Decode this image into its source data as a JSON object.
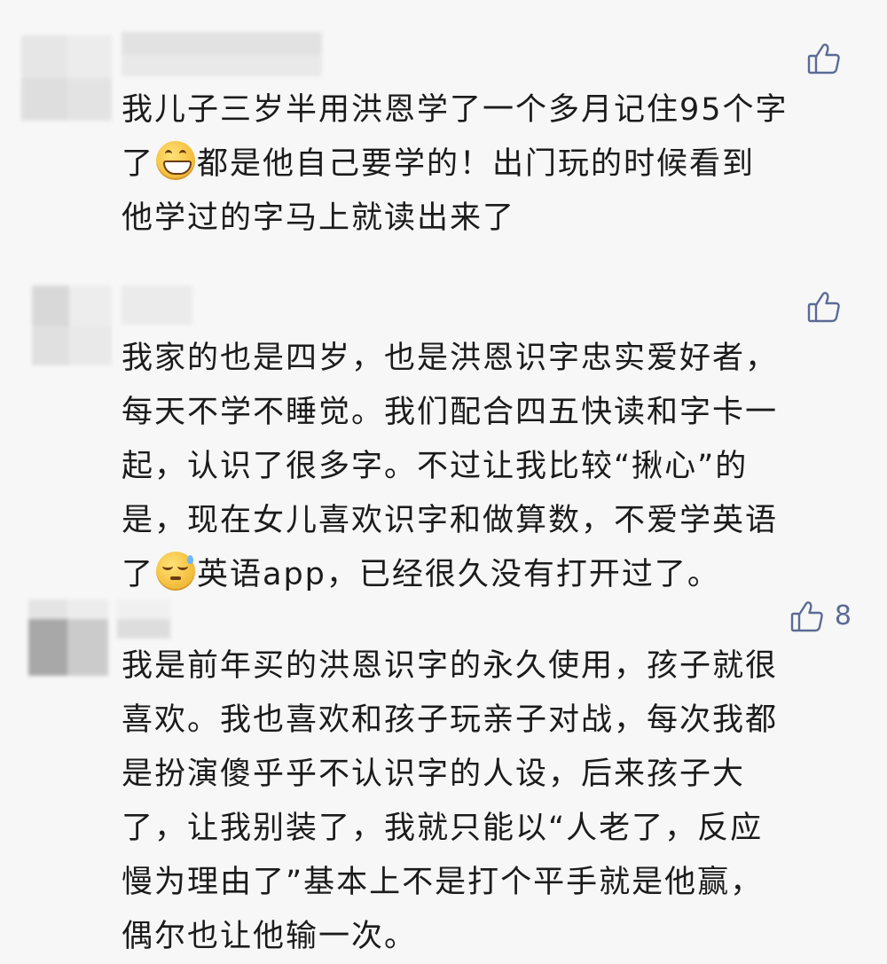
{
  "comments": [
    {
      "likes": "",
      "lines": [
        {
          "pre": "我儿子三岁半用洪恩学了一个多月记住95个字",
          "emoji": "",
          "post": ""
        },
        {
          "pre": "了",
          "emoji": "grinning-face-emoji",
          "post": "都是他自己要学的！出门玩的时候看到"
        },
        {
          "pre": "他学过的字马上就读出来了",
          "emoji": "",
          "post": ""
        }
      ]
    },
    {
      "likes": "",
      "lines": [
        {
          "pre": "我家的也是四岁，也是洪恩识字忠实爱好者，",
          "emoji": "",
          "post": ""
        },
        {
          "pre": "每天不学不睡觉。我们配合四五快读和字卡一",
          "emoji": "",
          "post": ""
        },
        {
          "pre": "起，认识了很多字。不过让我比较“揪心”的",
          "emoji": "",
          "post": ""
        },
        {
          "pre": "是，现在女儿喜欢识字和做算数，不爱学英语",
          "emoji": "",
          "post": ""
        },
        {
          "pre": "了",
          "emoji": "sweat-smile-emoji",
          "post": "英语app，已经很久没有打开过了。"
        }
      ]
    },
    {
      "likes": "8",
      "lines": [
        {
          "pre": "我是前年买的洪恩识字的永久使用，孩子就很",
          "emoji": "",
          "post": ""
        },
        {
          "pre": "喜欢。我也喜欢和孩子玩亲子对战，每次我都",
          "emoji": "",
          "post": ""
        },
        {
          "pre": "是扮演傻乎乎不认识字的人设，后来孩子大",
          "emoji": "",
          "post": ""
        },
        {
          "pre": "了，让我别装了，我就只能以“人老了，反应",
          "emoji": "",
          "post": ""
        },
        {
          "pre": "慢为理由了”基本上不是打个平手就是他赢，",
          "emoji": "",
          "post": ""
        },
        {
          "pre": "偶尔也让他输一次。",
          "emoji": "",
          "post": ""
        }
      ]
    }
  ],
  "icons": {
    "like": "thumbs-up-icon",
    "avatar": "blurred-avatar",
    "name": "blurred-username"
  },
  "colors": {
    "background": "#f7f7f7",
    "text": "#1b1b1b",
    "like": "#5b6b96"
  }
}
